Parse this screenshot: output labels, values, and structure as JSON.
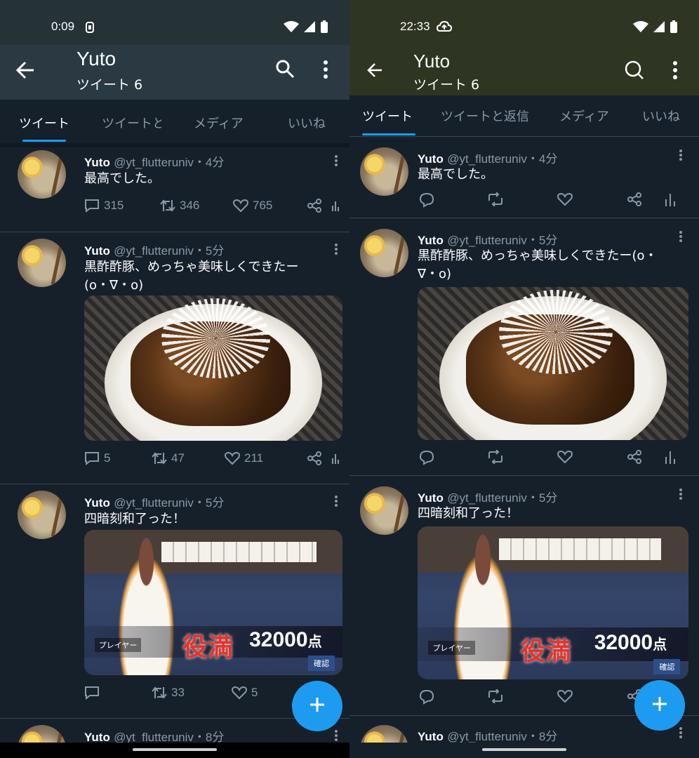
{
  "left": {
    "status": {
      "time": "0:09"
    },
    "header": {
      "title": "Yuto",
      "subtitle": "ツイート 6"
    },
    "tabs": [
      "ツイート",
      "ツイートと",
      "メディア",
      "いいね"
    ],
    "tweets": [
      {
        "name": "Yuto",
        "handle": "@yt_flutteruniv・4分",
        "text": "最高でした。",
        "replies": "315",
        "retweets": "346",
        "likes": "765"
      },
      {
        "name": "Yuto",
        "handle": "@yt_flutteruniv・5分",
        "text": "黒酢酢豚、めっちゃ美味しくできたー(o・∇・o)",
        "replies": "5",
        "retweets": "47",
        "likes": "211"
      },
      {
        "name": "Yuto",
        "handle": "@yt_flutteruniv・5分",
        "text": "四暗刻和了った！",
        "replies": "",
        "retweets": "33",
        "likes": "5"
      },
      {
        "name": "Yuto",
        "handle": "@yt_flutteruniv・8分"
      }
    ]
  },
  "right": {
    "status": {
      "time": "22:33"
    },
    "header": {
      "title": "Yuto",
      "subtitle": "ツイート 6"
    },
    "tabs": [
      "ツイート",
      "ツイートと返信",
      "メディア",
      "いいね"
    ],
    "tweets": [
      {
        "name": "Yuto",
        "handle": "@yt_flutteruniv・4分",
        "text": "最高でした。"
      },
      {
        "name": "Yuto",
        "handle": "@yt_flutteruniv・5分",
        "text": "黒酢酢豚、めっちゃ美味しくできたー(o・∇・o)"
      },
      {
        "name": "Yuto",
        "handle": "@yt_flutteruniv・5分",
        "text": "四暗刻和了った！"
      },
      {
        "name": "Yuto",
        "handle": "@yt_flutteruniv・8分"
      }
    ]
  },
  "game_image": {
    "yakuman": "役満",
    "score": "32000",
    "score_unit": "点",
    "player": "プレイヤー",
    "confirm": "確認"
  },
  "icons": [
    "back-arrow-icon",
    "search-icon",
    "more-vert-icon",
    "reply-icon",
    "retweet-icon",
    "like-icon",
    "share-icon",
    "analytics-icon",
    "compose-plus-icon",
    "wifi-icon",
    "signal-icon",
    "battery-icon"
  ],
  "colors": {
    "background": "#15202b",
    "accent": "#1d9bf0",
    "left_header": "#2b3a42",
    "right_header": "#2e3522",
    "muted": "#8b98a5"
  }
}
